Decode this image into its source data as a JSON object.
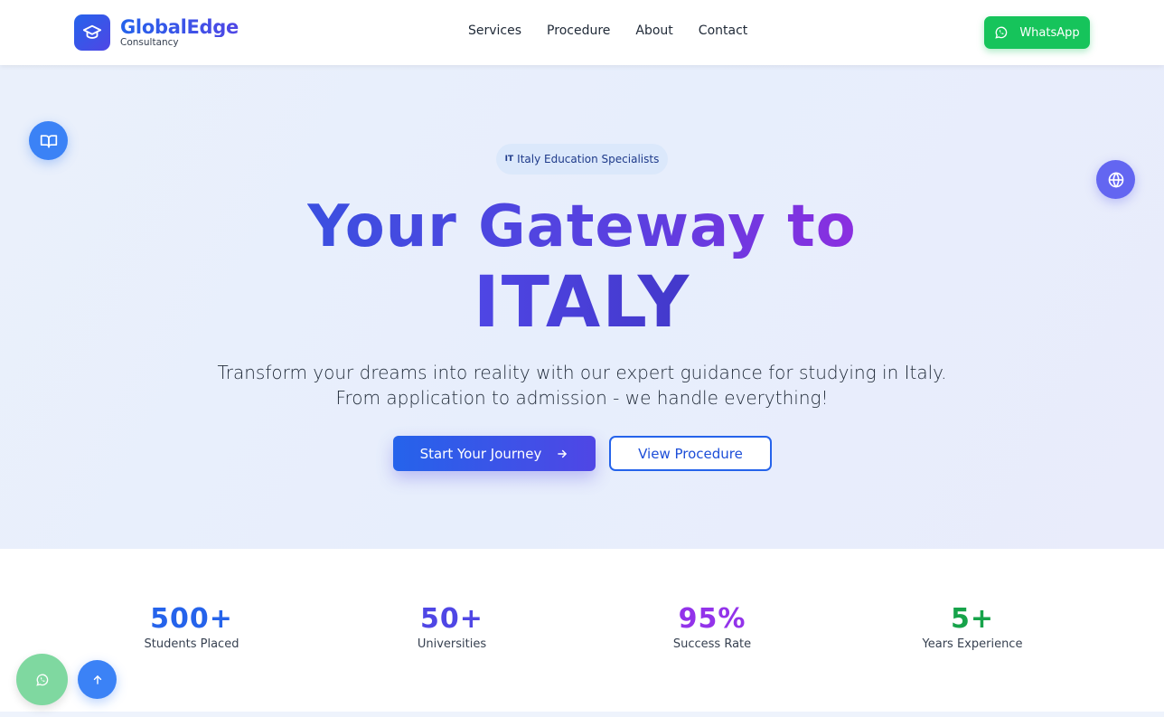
{
  "brand": {
    "name": "GlobalEdge",
    "subtitle": "Consultancy",
    "logo_icon": "graduation-cap-icon"
  },
  "nav": {
    "items": [
      "Services",
      "Procedure",
      "About",
      "Contact"
    ]
  },
  "header_cta": {
    "label": "WhatsApp",
    "icon": "whatsapp-icon",
    "color": "#16c45b"
  },
  "hero": {
    "badge": {
      "flag": "IT",
      "text": "Italy Education Specialists"
    },
    "headline_line1": "Your Gateway to",
    "headline_line2": "ITALY",
    "subtext_line1": "Transform your dreams into reality with our expert guidance for studying in Italy.",
    "subtext_line2": "From application to admission - we handle everything!",
    "primary_button": "Start Your Journey",
    "secondary_button": "View Procedure"
  },
  "stats": [
    {
      "value": "500+",
      "label": "Students Placed",
      "color": "#2563eb"
    },
    {
      "value": "50+",
      "label": "Universities",
      "color": "#4f46e5"
    },
    {
      "value": "95%",
      "label": "Success Rate",
      "color": "#9333ea"
    },
    {
      "value": "5+",
      "label": "Years Experience",
      "color": "#16a34a"
    }
  ],
  "floating": {
    "left_icon": "book-icon",
    "right_icon": "globe-icon",
    "fab_chat": "whatsapp-icon",
    "fab_top": "arrow-up-icon"
  },
  "colors": {
    "accent": "#2563eb",
    "accent2": "#4f46e5",
    "hero_bg": "#e8eefb"
  }
}
